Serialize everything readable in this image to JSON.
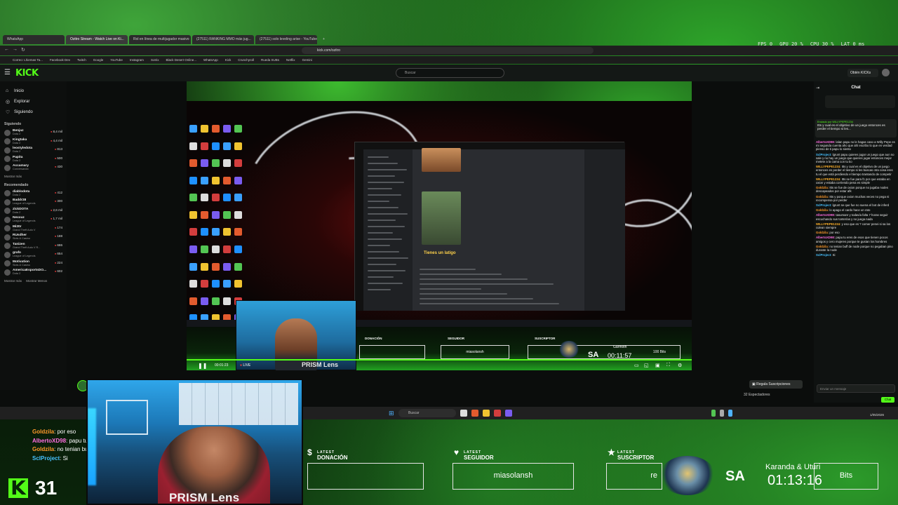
{
  "overlay_stats": {
    "fps_label": "FPS",
    "fps": "0",
    "gpu_label": "GPU",
    "gpu": "20 %",
    "cpu_label": "CPU",
    "cpu": "30 %",
    "lat_label": "LAT",
    "lat": "0 ms"
  },
  "browser": {
    "tabs": [
      "WhatsApp",
      "Ozitro Stream - Watch Live on Ki...",
      "Rol en línea de multijugador masivo",
      "(27511) RANKING MMO más jug...",
      "(27511) solo leveling arise - YouTube"
    ],
    "url": "kick.com/ozitro",
    "bookmarks": [
      "Correo: Lhiemas Ta...",
      "Facebook Dev",
      "Twitch",
      "Google",
      "YouTube",
      "Instagram",
      "Sotrix",
      "Black Desert Online...",
      "WhatsApp",
      "Kick",
      "Crunchyroll",
      "Rueda SUBs",
      "Netflix",
      "Gemini"
    ]
  },
  "kick": {
    "logo": "KICK",
    "search_placeholder": "Buscar",
    "get_kicks": "Obtén KICKs",
    "nav": [
      "Inicio",
      "Explorar",
      "Siguiendo"
    ],
    "following_title": "Siguiendo",
    "following": [
      {
        "name": "Benjaz",
        "game": "Dota 2",
        "viewers": "8,4 mil"
      },
      {
        "name": "Kingtaka",
        "game": "Dota 2",
        "viewers": "4,4 mil"
      },
      {
        "name": "leostyledota",
        "game": "Dota 2",
        "viewers": "813"
      },
      {
        "name": "Papita",
        "game": "Dota 2",
        "viewers": "500"
      },
      {
        "name": "Accamary",
        "game": "Conversando",
        "viewers": "430"
      }
    ],
    "show_more": "Mostrar más",
    "recommended_title": "Recomendado",
    "recommended": [
      {
        "name": "diablodota",
        "game": "Dota 2",
        "viewers": "412"
      },
      {
        "name": "Baddr28",
        "game": "League of Legends",
        "viewers": "300"
      },
      {
        "name": "zlckDOTA",
        "game": "Dota 2",
        "viewers": "2,6 mil"
      },
      {
        "name": "Nexxuz",
        "game": "League of Legends",
        "viewers": "1,7 mil"
      },
      {
        "name": "Mi20r",
        "game": "Grand Theft Auto V",
        "viewers": "174"
      },
      {
        "name": "RUsdher",
        "game": "Slots & Casino",
        "viewers": "188"
      },
      {
        "name": "Tanizen",
        "game": "Grand Theft Auto V R...",
        "viewers": "686"
      },
      {
        "name": "grafo",
        "game": "League of Legends",
        "viewers": "654"
      },
      {
        "name": "Motivation",
        "game": "Slots & Casino",
        "viewers": "224"
      },
      {
        "name": "AmericaEsportsDO...",
        "game": "Dota 2",
        "viewers": "602"
      }
    ],
    "show_more_2": "Mostrar más",
    "show_less": "Mostrar Menos",
    "gift_subs": "Regala Suscripciones",
    "viewers": "32 Espectadores"
  },
  "player": {
    "gif_caption": "Tienes un latigo",
    "cam_label": "PRISM Lens",
    "latest_donation": "DONACIÓN",
    "latest_follower": "SEGUIDOR",
    "latest_follower_value": "miasolansh",
    "latest_sub": "SUSCRIPTOR",
    "bits": "100 Bits",
    "sa": "SA",
    "names": "Garmoth",
    "timer": "00:11:57",
    "time": "00:01:23",
    "live": "LIVE"
  },
  "chat": {
    "title": "Chat",
    "pinned_label": "Enviado por WILLYPEPE1234",
    "pinned_msg": "Itts y cual es el objetivo de un juego entonces es perder el tiempo si les...",
    "messages": [
      {
        "user": "AlbertoXD98",
        "color": "#ff6ee0",
        "text": "lalan papu no le hagas caso a Willy Pepe es mi segunda cuenta aho que ahí escribo lo que en verdad pienso de ti papu lo siento"
      },
      {
        "user": "SclProject",
        "color": "#47c1ff",
        "text": "lgrunt papu quieres jugar un juego que aun no sale y no hay un juego que quieres jugar entonces mejor metete a la cama con tu tio"
      },
      {
        "user": "WILLYPEPE1234",
        "color": "#ffb12b",
        "text": "Itts y cual es el objetivo de un juego entonces es perder el tiempo si les buscas otra cosa eres tu el que está perdiendo el tiempo trantando de competir"
      },
      {
        "user": "WILLYPEPE1234",
        "color": "#ffb12b",
        "text": "Itts se fue para f1 por que estaba en oxion y estaba corriendo pena es simple"
      },
      {
        "user": "Goldzila",
        "color": "#ff9a2b",
        "text": "Itts se fue de oxion porque no jugaba nodes descapeados por estar afk"
      },
      {
        "user": "Goldzila",
        "color": "#ff9a2b",
        "text": "Itts y porque oxion muchas veces no pega ni recompensa por perder"
      },
      {
        "user": "SclProject",
        "color": "#47c1ff",
        "text": "lgrunt se que fue no suena el bot de inferd"
      },
      {
        "user": "Goldzila",
        "color": "#ff9a2b",
        "text": "lo apago el cardo hace un rato"
      },
      {
        "user": "AlbertoXD98",
        "color": "#ff6ee0",
        "text": "tasumanr y todavía falta 7 horas seguir escuchando sus tonterías y no juega nada"
      },
      {
        "user": "WILLYPEPE1234",
        "color": "#ffb12b",
        "text": "y eso que es ? comer penei si sa los culean siempre"
      },
      {
        "user": "Goldzila",
        "color": "#ff9a2b",
        "text": "por eso"
      },
      {
        "user": "AlbertoXD98",
        "color": "#ff6ee0",
        "text": "papu tu eres de esos que tienen pocos amigos y cero mujeres porque te gustan los hombres"
      },
      {
        "user": "Goldzila",
        "color": "#ff9a2b",
        "text": "no tenian buff de node porque no pegaban pino durante la node"
      },
      {
        "user": "SclProject",
        "color": "#47c1ff",
        "text": "Si"
      }
    ],
    "input_placeholder": "Enviar un mensaje",
    "send": "Chat"
  },
  "taskbar": {
    "search": "Buscar",
    "clock_time": "",
    "clock_date": "1/05/2026"
  },
  "overlay": {
    "chat": [
      {
        "user": "Goldzila",
        "color": "#ff9a2b",
        "text": ": por eso"
      },
      {
        "user": "AlbertoXD98",
        "color": "#ff6ee0",
        "text": ": papu tu"
      },
      {
        "user": "Goldzila",
        "color": "#ff9a2b",
        "text": ": no tenian bu"
      },
      {
        "user": "SclProject",
        "color": "#47c1ff",
        "text": ": Si"
      }
    ],
    "viewer_count": "31",
    "cam_label": "PRISM Lens",
    "latest_small": "LATEST",
    "donation": "DONACIÓN",
    "follower": "SEGUIDOR",
    "follower_value": "miasolansh",
    "sub": "SUSCRIPTOR",
    "sub_value": "re",
    "bits": "Bits",
    "sa": "SA",
    "names": "Karanda & Uturi",
    "timer": "01:13:16"
  },
  "colors": {
    "accent": "#53fc18"
  }
}
